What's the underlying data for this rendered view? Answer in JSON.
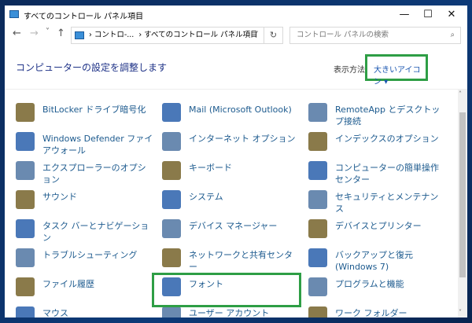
{
  "window": {
    "title": "すべてのコントロール パネル項目",
    "minimize": "—",
    "maximize": "☐",
    "close": "✕"
  },
  "nav": {
    "back": "←",
    "forward": "→",
    "recent": "˅",
    "up": "↑"
  },
  "address": {
    "crumb1": "› コントロ-...",
    "crumb2": "› すべてのコントロール パネル項目",
    "dropdown": "˅",
    "refresh": "↻"
  },
  "search": {
    "placeholder": "コントロール パネルの検索",
    "icon": "⌕"
  },
  "header": {
    "title": "コンピューターの設定を調整します",
    "view_label": "表示方法",
    "view_value": "大きいアイコン ▾"
  },
  "items": [
    [
      "BitLocker ドライブ暗号化",
      "Mail (Microsoft Outlook)",
      "RemoteApp とデスクトップ接続"
    ],
    [
      "Windows Defender ファイアウォール",
      "インターネット オプション",
      "インデックスのオプション"
    ],
    [
      "エクスプローラーのオプション",
      "キーボード",
      "コンピューターの簡単操作センター"
    ],
    [
      "サウンド",
      "システム",
      "セキュリティとメンテナンス"
    ],
    [
      "タスク バーとナビゲーション",
      "デバイス マネージャー",
      "デバイスとプリンター"
    ],
    [
      "トラブルシューティング",
      "ネットワークと共有センター",
      "バックアップと復元 (Windows 7)"
    ],
    [
      "ファイル履歴",
      "フォント",
      "プログラムと機能"
    ],
    [
      "マウス",
      "ユーザー アカウント",
      "ワーク フォルダー"
    ]
  ],
  "colors": {
    "highlight": "#2e9e45",
    "link": "#1c5a8e"
  }
}
